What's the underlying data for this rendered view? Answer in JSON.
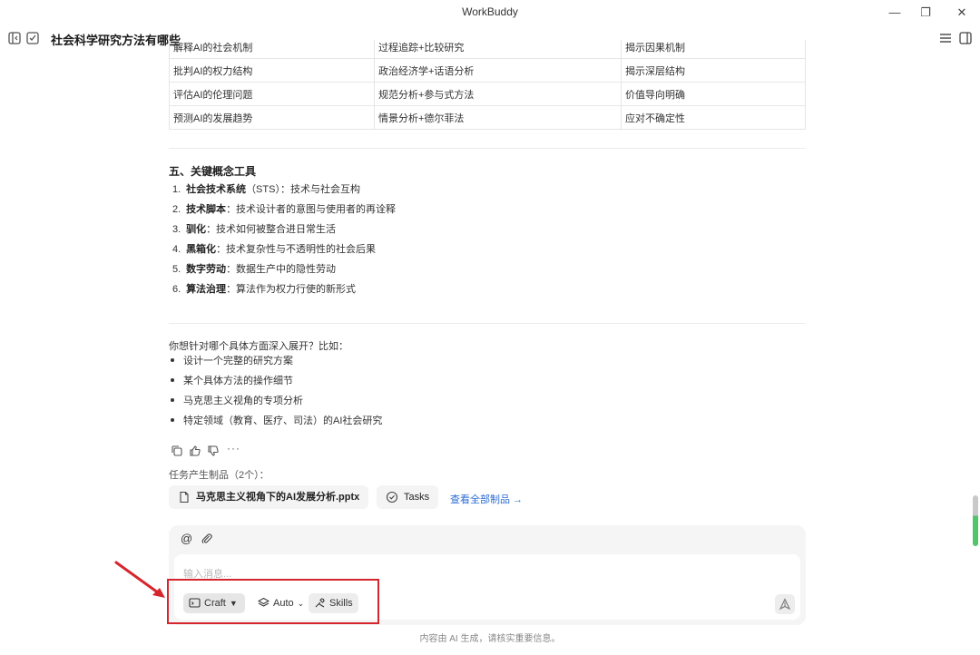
{
  "window": {
    "title": "WorkBuddy",
    "accent": "#2b6cd4"
  },
  "header": {
    "chat_title": "社会科学研究方法有哪些"
  },
  "table": {
    "rows": [
      [
        "解释AI的社会机制",
        "过程追踪+比较研究",
        "揭示因果机制"
      ],
      [
        "批判AI的权力结构",
        "政治经济学+话语分析",
        "揭示深层结构"
      ],
      [
        "评估AI的伦理问题",
        "规范分析+参与式方法",
        "价值导向明确"
      ],
      [
        "预测AI的发展趋势",
        "情景分析+德尔菲法",
        "应对不确定性"
      ]
    ]
  },
  "section": {
    "heading": "五、关键概念工具",
    "items": [
      {
        "num": "1.",
        "term": "社会技术系统",
        "rest": "（STS）：技术与社会互构"
      },
      {
        "num": "2.",
        "term": "技术脚本",
        "rest": "：技术设计者的意图与使用者的再诠释"
      },
      {
        "num": "3.",
        "term": "驯化",
        "rest": "：技术如何被整合进日常生活"
      },
      {
        "num": "4.",
        "term": "黑箱化",
        "rest": "：技术复杂性与不透明性的社会后果"
      },
      {
        "num": "5.",
        "term": "数字劳动",
        "rest": "：数据生产中的隐性劳动"
      },
      {
        "num": "6.",
        "term": "算法治理",
        "rest": "：算法作为权力行使的新形式"
      }
    ]
  },
  "followup": {
    "question": "你想针对哪个具体方面深入展开？比如：",
    "options": [
      "设计一个完整的研究方案",
      "某个具体方法的操作细节",
      "马克思主义视角的专项分析",
      "特定领域（教育、医疗、司法）的AI社会研究"
    ]
  },
  "actions": {
    "more": "···"
  },
  "artifacts": {
    "label": "任务产生制品（2个）：",
    "file_name": "马克思主义视角下的AI发展分析.pptx",
    "tasks_label": "Tasks",
    "view_all": "查看全部制品 →"
  },
  "composer": {
    "placeholder": "输入消息...",
    "mode_craft": "Craft",
    "mode_auto": "Auto",
    "skills": "Skills"
  },
  "footer": {
    "disclaimer": "内容由 AI 生成，请核实重要信息。"
  },
  "annotation": {
    "highlight_color": "#d6262d"
  }
}
